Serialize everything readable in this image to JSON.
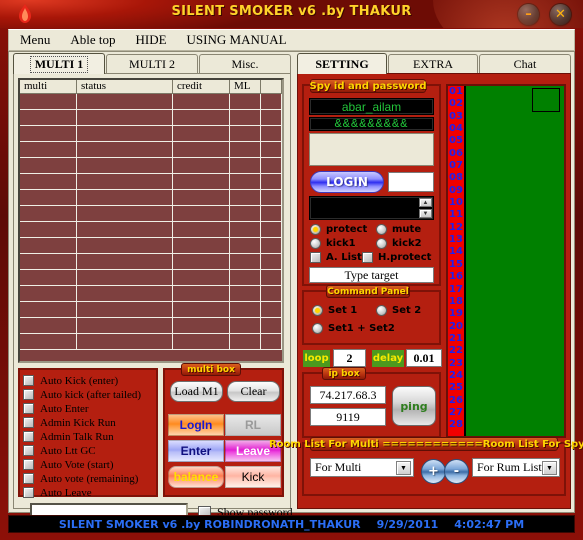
{
  "window": {
    "title": "SILENT SMOKER v6  .by THAKUR",
    "logo_icon": "flame-icon",
    "minimize_label": "–",
    "close_label": "✕"
  },
  "menubar": {
    "items": [
      {
        "label": "Menu"
      },
      {
        "label": "Able top"
      },
      {
        "label": "HIDE"
      },
      {
        "label": "USING MANUAL"
      }
    ]
  },
  "left_tabs": [
    {
      "label": "MULTI 1",
      "active": true
    },
    {
      "label": "MULTI 2",
      "active": false
    },
    {
      "label": "Misc.",
      "active": false
    }
  ],
  "right_tabs": [
    {
      "label": "SETTING",
      "active": true
    },
    {
      "label": "EXTRA",
      "active": false
    },
    {
      "label": "Chat",
      "active": false
    }
  ],
  "grid": {
    "columns": [
      "multi",
      "status",
      "credit",
      "ML",
      ""
    ],
    "row_count": 16,
    "rows": []
  },
  "auto_options": [
    {
      "label": "Auto Kick  (enter)",
      "checked": false
    },
    {
      "label": "Auto kick (after tailed)",
      "checked": false
    },
    {
      "label": "Auto Enter",
      "checked": false
    },
    {
      "label": "Admin Kick Run",
      "checked": false
    },
    {
      "label": "Admin Talk Run",
      "checked": false
    },
    {
      "label": "Auto Ltt GC",
      "checked": false
    },
    {
      "label": "Auto Vote  (start)",
      "checked": false
    },
    {
      "label": "Auto vote  (remaining)",
      "checked": false
    },
    {
      "label": "Auto Leave",
      "checked": false
    }
  ],
  "multibox": {
    "caption": "multi box",
    "load_label": "Load M1",
    "clear_label": "Clear",
    "login_label": "LogIn",
    "rl_label": "RL",
    "enter_label": "Enter",
    "leave_label": "Leave",
    "balance_label": "balance",
    "kick_label": "Kick"
  },
  "spy": {
    "caption": "Spy id and password",
    "username": "abar_ailam",
    "password_masked": "&&&&&&&&&",
    "login_label": "LOGIN",
    "side_value": "",
    "note_value": "",
    "log_value": "",
    "spin_up": "▲",
    "spin_down": "▼",
    "radios": [
      {
        "label": "protect",
        "selected": true
      },
      {
        "label": "mute",
        "selected": false
      },
      {
        "label": "kick1",
        "selected": false
      },
      {
        "label": "kick2",
        "selected": false
      }
    ],
    "checks": [
      {
        "label": "A. List",
        "checked": false
      },
      {
        "label": "H.protect",
        "checked": false
      }
    ],
    "target_label": "Type target"
  },
  "command_panel": {
    "caption": "Command Panel",
    "radios": [
      {
        "label": "Set 1",
        "selected": true
      },
      {
        "label": "Set 2",
        "selected": false
      },
      {
        "label": "Set1 + Set2",
        "selected": false
      }
    ],
    "loop_label": "loop",
    "loop_value": "2",
    "delay_label": "delay",
    "delay_value": "0.01"
  },
  "ip_box": {
    "caption": "ip box",
    "ip_value": "74.217.68.3",
    "port_value": "9119",
    "ping_label": "ping"
  },
  "number_list": {
    "numbers": [
      "01",
      "02",
      "03",
      "04",
      "05",
      "06",
      "07",
      "08",
      "09",
      "10",
      "11",
      "12",
      "13",
      "14",
      "15",
      "16",
      "17",
      "18",
      "19",
      "20",
      "21",
      "22",
      "23",
      "24",
      "25",
      "26",
      "27",
      "28"
    ]
  },
  "room_list": {
    "caption": "Room List For Multi ============Room List For  Spy Id",
    "multi_combo_value": "For Multi",
    "spy_combo_value": "For Rum List",
    "add_label": "+",
    "remove_label": "-",
    "combo_arrow": "▼"
  },
  "bottom": {
    "password_value": "",
    "show_password_label": "Show password",
    "show_password_checked": false
  },
  "statusbar": {
    "app": "SILENT SMOKER v6  .by ROBINDRONATH_THAKUR",
    "date": "9/29/2011",
    "time": "4:02:47 PM"
  },
  "colors": {
    "title_text": "#ffd32a",
    "panel_red": "#b41f10",
    "green_list": "#008000",
    "number_red": "#f00000",
    "number_blue": "#2020ee",
    "status_blue": "#2b6ef5",
    "input_green": "#22c43a"
  }
}
